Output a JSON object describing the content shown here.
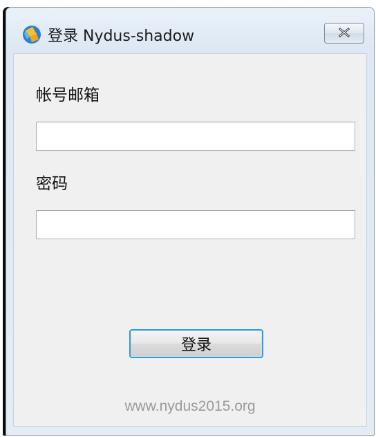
{
  "window": {
    "title": "登录 Nydus-shadow",
    "app_icon": "nydus-logo-icon",
    "close_icon": "close-icon"
  },
  "form": {
    "account_label": "帐号邮箱",
    "account_value": "",
    "password_label": "密码",
    "password_value": "",
    "login_button_label": "登录"
  },
  "footer": {
    "website": "www.nydus2015.org"
  },
  "colors": {
    "button_focus_border": "#3c95d6",
    "footer_text": "#9a9a9a",
    "client_background": "#f0f0f0"
  }
}
